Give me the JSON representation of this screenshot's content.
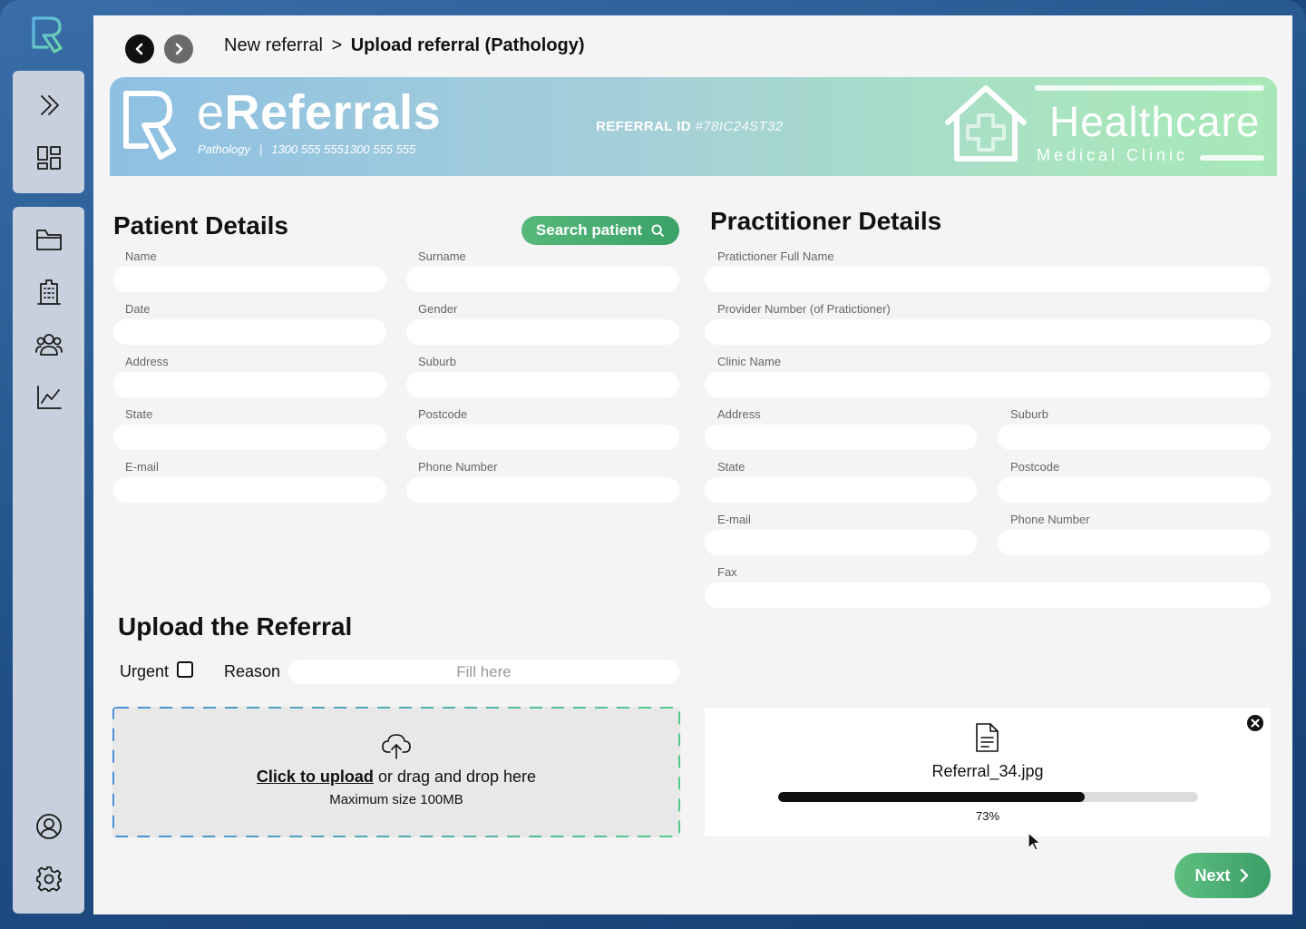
{
  "breadcrumb": {
    "parent": "New referral",
    "separator": ">",
    "current": "Upload referral (Pathology)"
  },
  "banner": {
    "title_light": "e",
    "title_bold": "Referrals",
    "subtitle_dept": "Pathology",
    "subtitle_sep": "|",
    "subtitle_phone": "1300 555 5551300 555 555",
    "ref_id_label": "REFERRAL ID",
    "ref_id_value": "#78IC24ST32",
    "clinic_name": "Healthcare",
    "clinic_sub": "Medical Clinic"
  },
  "patient": {
    "title": "Patient Details",
    "search_label": "Search patient",
    "fields": {
      "name": "Name",
      "surname": "Surname",
      "date": "Date",
      "gender": "Gender",
      "address": "Address",
      "suburb": "Suburb",
      "state": "State",
      "postcode": "Postcode",
      "email": "E-mail",
      "phone": "Phone Number"
    }
  },
  "practitioner": {
    "title": "Practitioner Details",
    "fields": {
      "full_name": "Pratictioner Full Name",
      "provider_number": "Provider Number (of Pratictioner)",
      "clinic_name": "Clinic Name",
      "address": "Address",
      "suburb": "Suburb",
      "state": "State",
      "postcode": "Postcode",
      "email": "E-mail",
      "phone": "Phone Number",
      "fax": "Fax"
    }
  },
  "upload": {
    "title": "Upload the Referral",
    "urgent_label": "Urgent",
    "urgent_checked": false,
    "reason_label": "Reason",
    "reason_placeholder": "Fill here",
    "click_to_upload": "Click to upload",
    "drag_text": " or drag and drop here",
    "max_size": "Maximum size 100MB",
    "file_name": "Referral_34.jpg",
    "progress_text": "73%",
    "progress_value": 0.73
  },
  "actions": {
    "next_label": "Next"
  },
  "colors": {
    "accent_green": "#3aa268",
    "sidebar_bg": "#c7d0dc",
    "frame_blue": "#1f4f86"
  },
  "icons": {
    "sidebar_top": [
      "expand-icon",
      "dashboard-icon"
    ],
    "sidebar_nav": [
      "folder-icon",
      "building-icon",
      "users-icon",
      "chart-icon"
    ],
    "sidebar_bottom": [
      "profile-icon",
      "settings-icon"
    ]
  }
}
